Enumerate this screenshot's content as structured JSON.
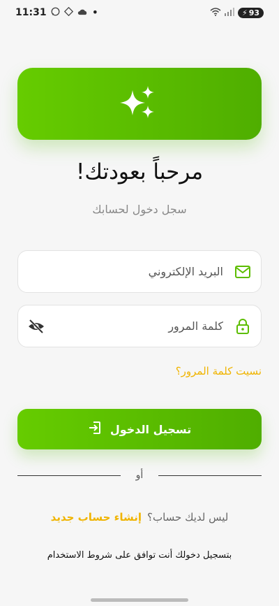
{
  "status_bar": {
    "time": "11:31",
    "battery": "93"
  },
  "hero": {
    "icon": "sparkles-icon"
  },
  "title": "مرحباً بعودتك!",
  "subtitle": "سجل دخول لحسابك",
  "email": {
    "placeholder": "البريد الإلكتروني",
    "value": "",
    "icon": "mail-icon"
  },
  "password": {
    "placeholder": "كلمة المرور",
    "value": "",
    "icon": "lock-icon",
    "toggle_icon": "eye-off-icon"
  },
  "forgot_password": "نسيت كلمة المرور؟",
  "login_button": "تسجيل الدخول",
  "divider_text": "أو",
  "signup": {
    "question": "ليس لديك حساب؟",
    "link": "إنشاء حساب جديد"
  },
  "terms": "بتسجيل دخولك أنت توافق على شروط الاستخدام",
  "colors": {
    "primary": "#5cbd00",
    "accent": "#f0b400",
    "background": "#f6f6f6"
  }
}
